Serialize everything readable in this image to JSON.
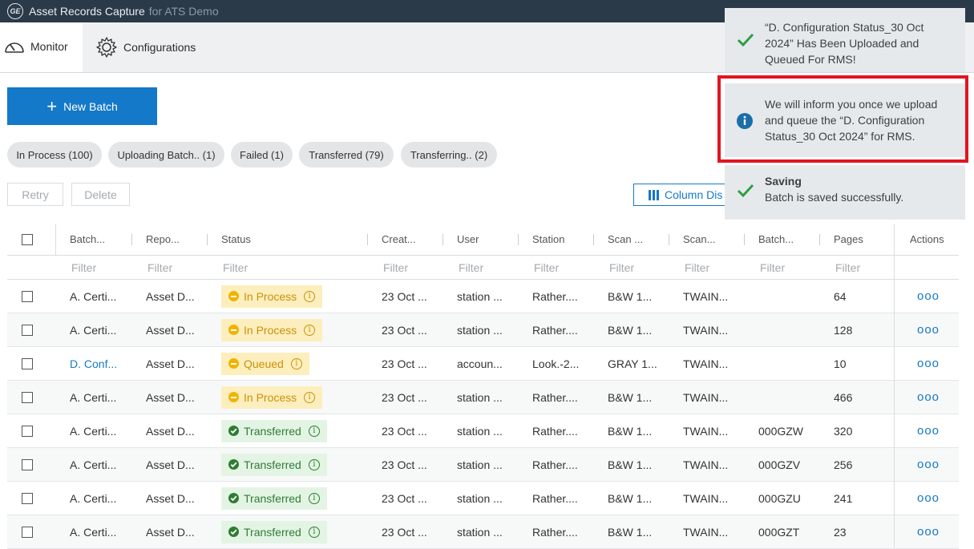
{
  "app": {
    "title": "Asset Records Capture",
    "subtitle": "for ATS Demo",
    "logo_text": "GE"
  },
  "nav": {
    "monitor": "Monitor",
    "configurations": "Configurations"
  },
  "toolbar": {
    "new_batch": "New Batch",
    "chips": [
      "In Process (100)",
      "Uploading Batch.. (1)",
      "Failed (1)",
      "Transferred (79)",
      "Transferring.. (2)"
    ],
    "retry": "Retry",
    "delete": "Delete",
    "column_display": "Column Dis"
  },
  "table": {
    "headers": [
      "Batch...",
      "Repo...",
      "Status",
      "Creat...",
      "User",
      "Station",
      "Scan ...",
      "Scan...",
      "Batch...",
      "Pages",
      "Actions"
    ],
    "filter_placeholder": "Filter",
    "rows": [
      {
        "batch": "A. Certi...",
        "repo": "Asset D...",
        "status": "In Process",
        "status_color": "#f0b400",
        "created": "23 Oct ...",
        "user": "station ...",
        "station": "Rather....",
        "scan1": "B&W 1...",
        "scan2": "TWAIN...",
        "batch2": "",
        "pages": "64",
        "actions": "ooo"
      },
      {
        "batch": "A. Certi...",
        "repo": "Asset D...",
        "status": "In Process",
        "status_color": "#f0b400",
        "created": "23 Oct ...",
        "user": "station ...",
        "station": "Rather....",
        "scan1": "B&W 1...",
        "scan2": "TWAIN...",
        "batch2": "",
        "pages": "128",
        "actions": "ooo"
      },
      {
        "batch": "D. Conf...",
        "repo": "Asset D...",
        "status": "Queued",
        "status_color": "#f0b400",
        "created": "23 Oct ...",
        "user": "accoun...",
        "station": "Look.-2...",
        "scan1": "GRAY 1...",
        "scan2": "TWAIN...",
        "batch2": "",
        "pages": "10",
        "actions": "ooo"
      },
      {
        "batch": "A. Certi...",
        "repo": "Asset D...",
        "status": "In Process",
        "status_color": "#f0b400",
        "created": "23 Oct ...",
        "user": "station ...",
        "station": "Rather....",
        "scan1": "B&W 1...",
        "scan2": "TWAIN...",
        "batch2": "",
        "pages": "466",
        "actions": "ooo"
      },
      {
        "batch": "A. Certi...",
        "repo": "Asset D...",
        "status": "Transferred",
        "status_color": "#2e7d32",
        "created": "23 Oct ...",
        "user": "station ...",
        "station": "Rather....",
        "scan1": "B&W 1...",
        "scan2": "TWAIN...",
        "batch2": "000GZW",
        "pages": "320",
        "actions": "ooo"
      },
      {
        "batch": "A. Certi...",
        "repo": "Asset D...",
        "status": "Transferred",
        "status_color": "#2e7d32",
        "created": "23 Oct ...",
        "user": "station ...",
        "station": "Rather....",
        "scan1": "B&W 1...",
        "scan2": "TWAIN...",
        "batch2": "000GZV",
        "pages": "256",
        "actions": "ooo"
      },
      {
        "batch": "A. Certi...",
        "repo": "Asset D...",
        "status": "Transferred",
        "status_color": "#2e7d32",
        "created": "23 Oct ...",
        "user": "station ...",
        "station": "Rather....",
        "scan1": "B&W 1...",
        "scan2": "TWAIN...",
        "batch2": "000GZU",
        "pages": "241",
        "actions": "ooo"
      },
      {
        "batch": "A. Certi...",
        "repo": "Asset D...",
        "status": "Transferred",
        "status_color": "#2e7d32",
        "created": "23 Oct ...",
        "user": "station ...",
        "station": "Rather....",
        "scan1": "B&W 1...",
        "scan2": "TWAIN...",
        "batch2": "000GZT",
        "pages": "23",
        "actions": "ooo"
      }
    ]
  },
  "notifications": [
    {
      "type": "success",
      "icon": "check-icon",
      "title": "",
      "text": "“D. Configuration Status_30 Oct 2024” Has Been Uploaded and Queued For RMS!"
    },
    {
      "type": "info",
      "icon": "info-icon",
      "title": "",
      "text": "We will inform you once we upload and queue the “D. Configuration Status_30 Oct 2024” for RMS.",
      "highlighted": true
    },
    {
      "type": "success",
      "icon": "check-icon",
      "title": "Saving",
      "text": "Batch is saved successfully."
    }
  ],
  "colors": {
    "accent": "#1479c9",
    "titlebar": "#2b3a48",
    "warning": "#f0b400",
    "success": "#2e7d32",
    "highlight": "#e3141f"
  }
}
